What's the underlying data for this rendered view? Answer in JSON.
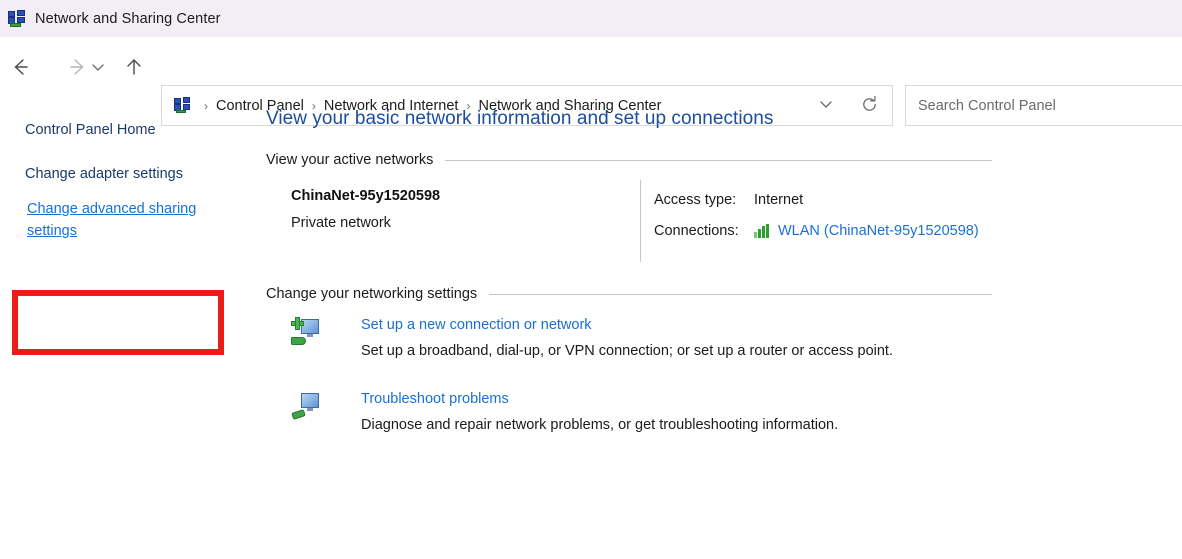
{
  "window": {
    "title": "Network and Sharing Center",
    "icon": "network-sharing-icon"
  },
  "nav": {
    "back": "back-arrow-icon",
    "forward": "forward-arrow-icon",
    "recent": "recent-locations-chevron-icon",
    "up": "up-arrow-icon",
    "refresh": "refresh-icon",
    "dropdown": "address-dropdown-chevron-icon"
  },
  "address": {
    "icon": "network-sharing-icon",
    "crumbs": [
      {
        "label": "Control Panel"
      },
      {
        "label": "Network and Internet"
      },
      {
        "label": "Network and Sharing Center"
      }
    ],
    "separator": "›"
  },
  "search": {
    "placeholder": "Search Control Panel",
    "value": ""
  },
  "sidebar": {
    "items": [
      {
        "label": "Control Panel Home",
        "state": "normal"
      },
      {
        "label": "Change adapter settings",
        "state": "normal"
      },
      {
        "label": "Change advanced sharing settings",
        "state": "hover-highlighted"
      }
    ],
    "highlight_color": "#ef1b1b"
  },
  "main": {
    "heading": "View your basic network information and set up connections",
    "sections": [
      {
        "label": "View your active networks"
      },
      {
        "label": "Change your networking settings"
      }
    ],
    "active_network": {
      "name": "ChinaNet-95y1520598",
      "type": "Private network",
      "details": [
        {
          "key": "Access type:",
          "value": "Internet",
          "is_link": false
        },
        {
          "key": "Connections:",
          "value": "WLAN (ChinaNet-95y1520598)",
          "is_link": true,
          "icon": "wifi-signal-icon"
        }
      ]
    },
    "tasks": [
      {
        "icon": "new-connection-icon",
        "link": "Set up a new connection or network",
        "description": "Set up a broadband, dial-up, or VPN connection; or set up a router or access point."
      },
      {
        "icon": "troubleshoot-icon",
        "link": "Troubleshoot problems",
        "description": "Diagnose and repair network problems, or get troubleshooting information."
      }
    ]
  },
  "colors": {
    "titlebar_bg": "#f3eef6",
    "heading_blue": "#1b4da0",
    "link_blue": "#1a6fd4",
    "sidebar_text": "#1b3a6b",
    "highlight_red": "#ef1b1b"
  }
}
